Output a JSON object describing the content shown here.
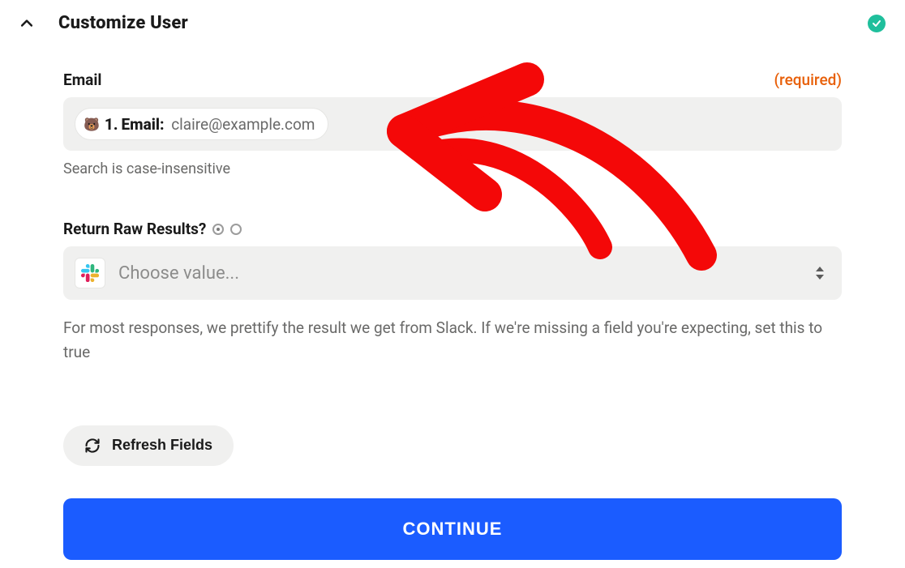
{
  "header": {
    "title": "Customize User"
  },
  "email": {
    "label": "Email",
    "required_text": "(required)",
    "pill_number": "1.",
    "pill_field": "Email:",
    "pill_value": "claire@example.com",
    "helper": "Search is case-insensitive"
  },
  "raw": {
    "label": "Return Raw Results?",
    "placeholder": "Choose value...",
    "helper": "For most responses, we prettify the result we get from Slack. If we're missing a field you're expecting, set this to true"
  },
  "buttons": {
    "refresh": "Refresh Fields",
    "continue": "CONTINUE"
  }
}
